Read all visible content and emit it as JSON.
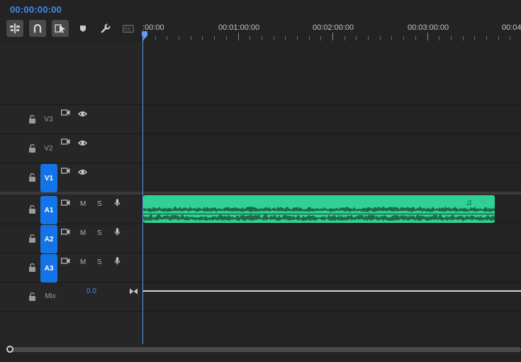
{
  "timecode": "00:00:00:00",
  "ruler": {
    "labels": [
      ":00:00",
      "00:01:00:00",
      "00:02:00:00",
      "00:03:00:00",
      "00:04"
    ]
  },
  "tracks": [
    {
      "name": "V3",
      "type": "video",
      "targeted": false
    },
    {
      "name": "V2",
      "type": "video",
      "targeted": false
    },
    {
      "name": "V1",
      "type": "video",
      "targeted": true
    },
    {
      "name": "A1",
      "type": "audio",
      "targeted": true
    },
    {
      "name": "A2",
      "type": "audio",
      "targeted": true
    },
    {
      "name": "A3",
      "type": "audio",
      "targeted": true
    }
  ],
  "audio_controls": {
    "mute": "M",
    "solo": "S"
  },
  "mix": {
    "name": "Mix",
    "value": "0.0"
  },
  "clip": {
    "track": "A1",
    "color": "#2fd197",
    "note_symbol": "♫",
    "fx_label": "fx"
  },
  "colors": {
    "accent": "#3d8bea",
    "track_target": "#1473e6",
    "background": "#232323"
  },
  "icons": {
    "toolbar": [
      "insert-sequence-icon",
      "snap-magnet-icon",
      "linked-selection-icon",
      "add-marker-icon",
      "settings-wrench-icon",
      "captions-icon"
    ],
    "video_track": [
      "lock-icon",
      "sync-lock-icon",
      "eye-icon"
    ],
    "audio_track": [
      "lock-icon",
      "sync-lock-icon",
      "microphone-icon"
    ],
    "mix_track": [
      "lock-icon",
      "bowtie-icon"
    ]
  }
}
